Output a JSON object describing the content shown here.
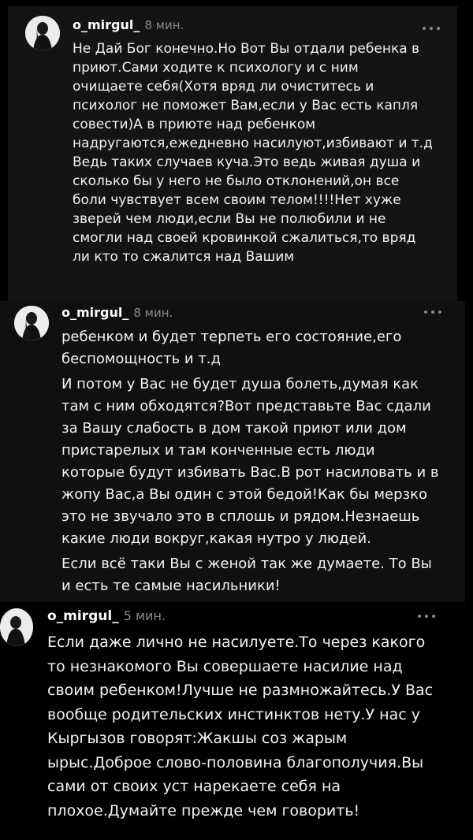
{
  "comments": [
    {
      "username": "o_mirgul_",
      "time": "8 мин.",
      "lines": [
        "Не Дай Бог конечно.Но Вот Вы отдали ребенка в",
        "приют.Сами ходите к психологу и с ним",
        "очищаете себя(Хотя вряд ли очиститесь и",
        "психолог не поможет Вам,если у Вас есть капля",
        "совести)А в приюте над ребенком",
        "надругаются,ежедневно насилуют,избивают и т.д",
        "Ведь таких случаев куча.Это ведь живая душа и",
        "сколько бы у него не было отклонений,он все",
        "боли чувствует всем своим телом!!!!Нет хуже",
        "зверей чем люди,если Вы не полюбили и не",
        "смогли над своей кровинкой сжалиться,то вряд",
        "ли кто то сжалится над Вашим"
      ]
    },
    {
      "username": "o_mirgul_",
      "time": "8 мин.",
      "paragraphs": [
        [
          "ребенком и будет терпеть его состояние,его",
          "беспомощность и т.д"
        ],
        [
          "И потом у Вас не будет душа болеть,думая как",
          "там с ним обходятся?Вот представьте Вас сдали",
          "за Вашу слабость в дом такой приют или дом",
          "пристарелых и там конченные есть люди",
          "которые будут избивать Вас.В рот насиловать и в",
          "жопу Вас,а Вы один с этой бедой!Как бы мерзко",
          "это не звучало это в сплошь и рядом.Незнаешь",
          "какие люди вокруг,какая нутро у людей."
        ],
        [
          "Если всё таки Вы с женой так же думаете. То Вы",
          "и есть те самые насильники!"
        ]
      ]
    },
    {
      "username": "o_mirgul_",
      "time": "5 мин.",
      "lines": [
        "Если даже лично не насилуете.То через какого",
        "то незнакомого Вы совершаете насилие над",
        "своим ребенком!Лучше не размножайтесь.У Вас",
        "вообще родительских инстинктов нету.У нас у",
        "Кыргызов говорят:Жакшы соз жарым",
        "ырыс.Доброе слово-половина благополучия.Вы",
        "сами от своих уст нарекаете себя на",
        "плохое.Думайте прежде чем говорить!"
      ]
    }
  ]
}
